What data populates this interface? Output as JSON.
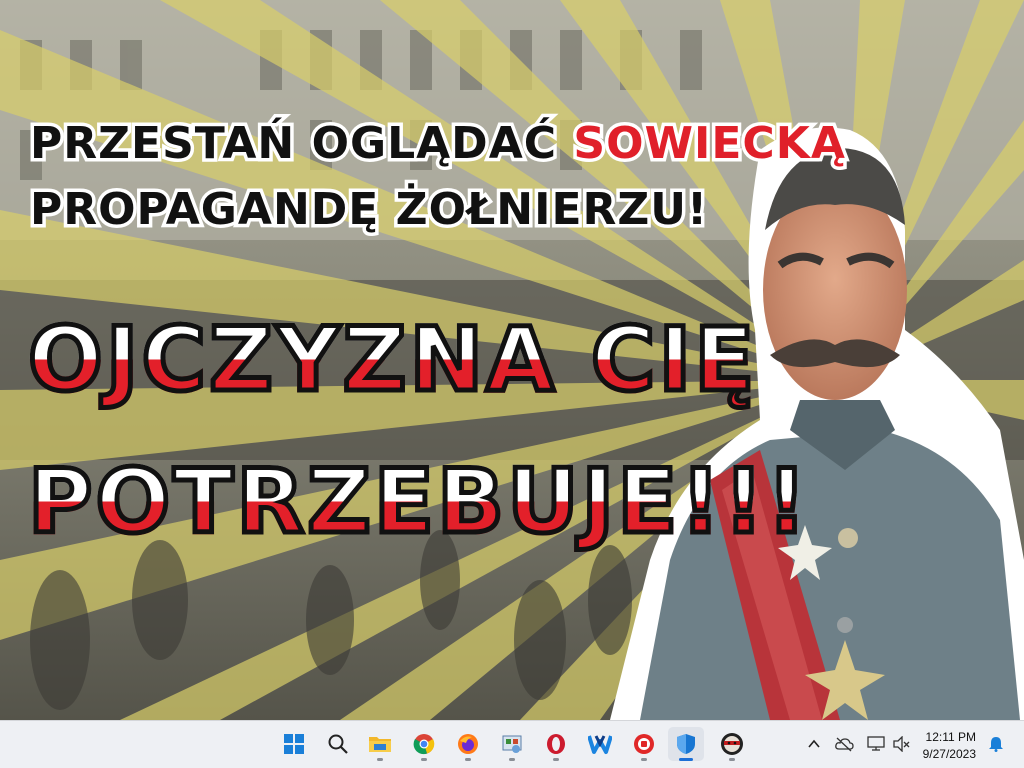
{
  "wallpaper": {
    "headline": {
      "line1_prefix": "PRZESTAŃ OGLĄDAĆ ",
      "line1_accent": "SOWIECKĄ",
      "line2": "PROPAGANDĘ ŻOŁNIERZU!"
    },
    "slogan": {
      "line1": "OJCZYZNA CIĘ",
      "line2": "POTRZEBUJE!!!"
    },
    "colors": {
      "ray_yellow": "#d9cf6a",
      "ray_gray": "#6e6d62",
      "accent_red": "#e0202a",
      "flag_white": "#ffffff"
    }
  },
  "taskbar": {
    "apps": [
      {
        "name": "Start",
        "icon": "windows-start-icon"
      },
      {
        "name": "Search",
        "icon": "search-icon"
      },
      {
        "name": "File Explorer",
        "icon": "folder-icon"
      },
      {
        "name": "Google Chrome",
        "icon": "chrome-icon"
      },
      {
        "name": "Firefox",
        "icon": "firefox-icon"
      },
      {
        "name": "Control Panel",
        "icon": "control-panel-icon"
      },
      {
        "name": "Opera",
        "icon": "opera-icon"
      },
      {
        "name": "Wise App",
        "icon": "w-app-icon"
      },
      {
        "name": "Record App",
        "icon": "record-icon"
      },
      {
        "name": "Windows Security",
        "icon": "shield-icon"
      },
      {
        "name": "Ninja App",
        "icon": "ninja-app-icon"
      }
    ],
    "active_app": "Windows Security",
    "tray": {
      "icons": [
        "chevron-up-icon",
        "cloud-off-icon",
        "monitor-icon",
        "speaker-muted-icon",
        "bell-icon"
      ],
      "time": "12:11 PM",
      "date": "9/27/2023"
    }
  }
}
